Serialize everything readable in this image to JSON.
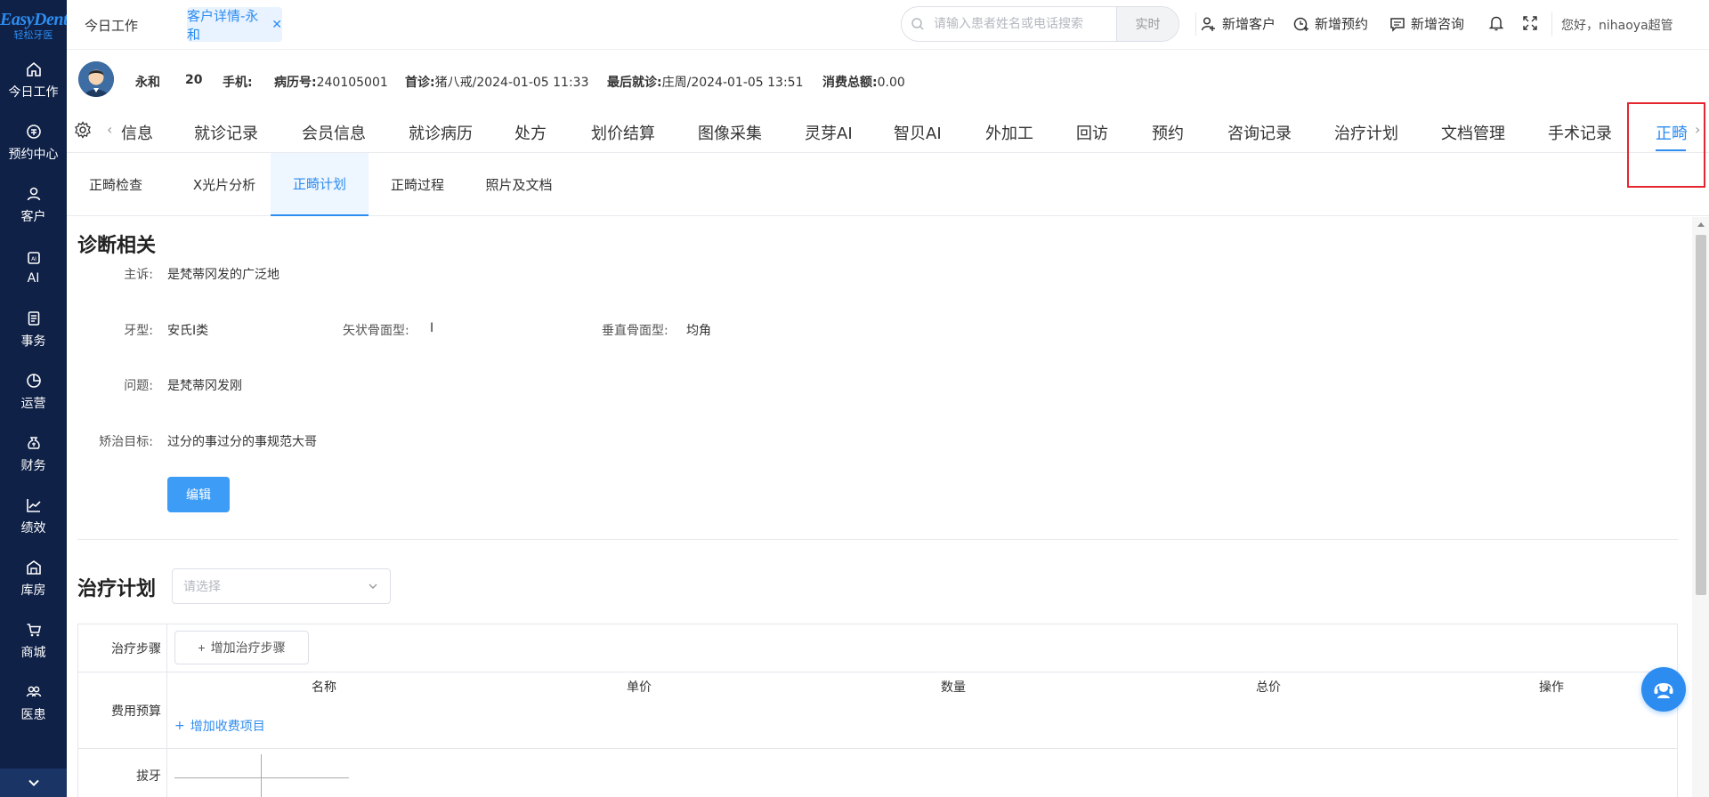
{
  "brand": {
    "name_en": "EasyDent",
    "name_cn": "轻松牙医",
    "accent": "#2d8cf0",
    "sidebar_bg": "#0f2147"
  },
  "sidebar": {
    "items": [
      {
        "label": "今日工作",
        "icon": "home-icon"
      },
      {
        "label": "预约中心",
        "icon": "calendar-icon"
      },
      {
        "label": "客户",
        "icon": "user-icon"
      },
      {
        "label": "AI",
        "icon": "ai-chip-icon"
      },
      {
        "label": "事务",
        "icon": "document-icon"
      },
      {
        "label": "运营",
        "icon": "pie-chart-icon"
      },
      {
        "label": "财务",
        "icon": "money-bag-icon"
      },
      {
        "label": "绩效",
        "icon": "line-chart-icon"
      },
      {
        "label": "库房",
        "icon": "warehouse-icon"
      },
      {
        "label": "商城",
        "icon": "cart-icon"
      },
      {
        "label": "医患",
        "icon": "people-icon"
      }
    ]
  },
  "header": {
    "tab_today": "今日工作",
    "tab_active": "客户详情-永和",
    "search_placeholder": "请输入患者姓名或电话搜索",
    "search_mode": "实时",
    "actions": {
      "new_customer": "新增客户",
      "new_appointment": "新增预约",
      "new_consult": "新增咨询"
    },
    "greeting": "您好，nihaoya超管"
  },
  "patient": {
    "name": "永和",
    "age": "20",
    "phone_label": "手机:",
    "record_label": "病历号:",
    "record_no": "240105001",
    "first_visit_label": "首诊:",
    "first_visit": "猪八戒/2024-01-05 11:33",
    "last_visit_label": "最后就诊:",
    "last_visit": "庄周/2024-01-05 13:51",
    "total_label": "消费总额:",
    "total": "0.00"
  },
  "main_tabs": [
    "信息",
    "就诊记录",
    "会员信息",
    "就诊病历",
    "处方",
    "划价结算",
    "图像采集",
    "灵芽AI",
    "智贝AI",
    "外加工",
    "回访",
    "预约",
    "咨询记录",
    "治疗计划",
    "文档管理",
    "手术记录",
    "正畸"
  ],
  "main_tab_active": "正畸",
  "sub_tabs": [
    "正畸检查",
    "X光片分析",
    "正畸计划",
    "正畸过程",
    "照片及文档"
  ],
  "sub_tab_active": "正畸计划",
  "diagnosis": {
    "title": "诊断相关",
    "complaint_label": "主诉:",
    "complaint": "是梵蒂冈发的广泛地",
    "tooth_type_label": "牙型:",
    "tooth_type": "安氏Ⅰ类",
    "sagittal_label": "矢状骨面型:",
    "sagittal": "Ⅰ",
    "vertical_label": "垂直骨面型:",
    "vertical": "均角",
    "problem_label": "问题:",
    "problem": "是梵蒂冈发刚",
    "goal_label": "矫治目标:",
    "goal": "过分的事过分的事规范大哥",
    "edit_button": "编辑"
  },
  "treatment_plan": {
    "title": "治疗计划",
    "select_placeholder": "请选择",
    "steps_label": "治疗步骤",
    "add_step_button": "增加治疗步骤",
    "budget_label": "费用预算",
    "columns": [
      "名称",
      "单价",
      "数量",
      "总价",
      "操作"
    ],
    "add_fee_item": "增加收费项目",
    "extraction_label": "拔牙"
  }
}
